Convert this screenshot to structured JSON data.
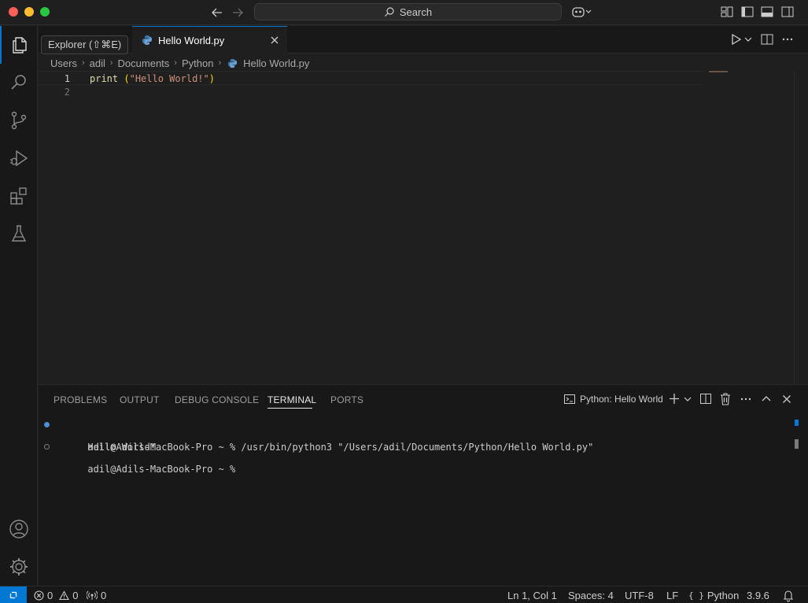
{
  "window": {
    "search_placeholder": "Search"
  },
  "activity": {
    "tooltip": "Explorer (⇧⌘E)"
  },
  "tab": {
    "title": "Hello World.py"
  },
  "breadcrumb": {
    "items": [
      "Users",
      "adil",
      "Documents",
      "Python",
      "Hello World.py"
    ]
  },
  "editor": {
    "line_numbers": [
      "1",
      "2"
    ],
    "code": {
      "fn": "print",
      "space": " ",
      "open_paren": "(",
      "string": "\"Hello World!\"",
      "close_paren": ")"
    }
  },
  "panel": {
    "tabs": [
      "PROBLEMS",
      "OUTPUT",
      "DEBUG CONSOLE",
      "TERMINAL",
      "PORTS"
    ],
    "active_tab": "TERMINAL",
    "terminal_name": "Python: Hello World",
    "terminal_lines": [
      "adil@Adils-MacBook-Pro ~ % /usr/bin/python3 \"/Users/adil/Documents/Python/Hello World.py\"",
      "Hello World!",
      "adil@Adils-MacBook-Pro ~ % "
    ]
  },
  "status": {
    "errors": "0",
    "warnings": "0",
    "ports": "0",
    "cursor": "Ln 1, Col 1",
    "spaces": "Spaces: 4",
    "encoding": "UTF-8",
    "eol": "LF",
    "language": "Python",
    "version": "3.9.6"
  },
  "colors": {
    "accent": "#0078d4",
    "editor_bg": "#1f1f1f",
    "sidebar_bg": "#181818",
    "string": "#ce9178",
    "function": "#dcdcaa",
    "bracket": "#ffd700"
  }
}
